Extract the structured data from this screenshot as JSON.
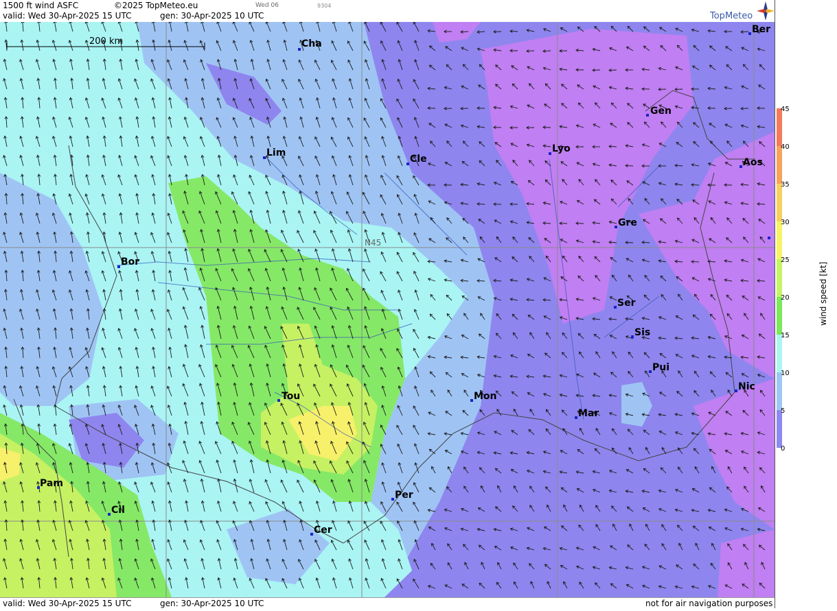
{
  "header": {
    "product": "1500 ft wind ASFC",
    "copyright": "©2025 TopMeteo.eu",
    "day_short": "Wed 06",
    "code": "9304",
    "valid": "valid:  Wed  30-Apr-2025  15 UTC",
    "gen": "gen:  30-Apr-2025 10 UTC",
    "brand": "TopMeteo"
  },
  "footer": {
    "valid": "valid:  Wed  30-Apr-2025  15 UTC",
    "gen": "gen:  30-Apr-2025 10 UTC",
    "disclaimer": "not for air navigation purposes"
  },
  "map": {
    "scale_label": "200 km",
    "lat_label": "N45",
    "cities": [
      {
        "name": "Cha",
        "key": "chateauroux"
      },
      {
        "name": "Ber",
        "key": "bern"
      },
      {
        "name": "Gen",
        "key": "geneva"
      },
      {
        "name": "Lim",
        "key": "limoges"
      },
      {
        "name": "Cle",
        "key": "clermont"
      },
      {
        "name": "Lyo",
        "key": "lyon"
      },
      {
        "name": "Aos",
        "key": "aosta"
      },
      {
        "name": "Gre",
        "key": "grenoble"
      },
      {
        "name": "Bor",
        "key": "bordeaux"
      },
      {
        "name": "Ser",
        "key": "serres"
      },
      {
        "name": "Sis",
        "key": "sisteron"
      },
      {
        "name": "Pui",
        "key": "puimoisson"
      },
      {
        "name": "Tou",
        "key": "toulouse"
      },
      {
        "name": "Mon",
        "key": "montpellier"
      },
      {
        "name": "Nic",
        "key": "nice"
      },
      {
        "name": "Mar",
        "key": "marseille"
      },
      {
        "name": "Pam",
        "key": "pamplona"
      },
      {
        "name": "Cil",
        "key": "cildamoc"
      },
      {
        "name": "Per",
        "key": "perpignan"
      },
      {
        "name": "Cer",
        "key": "cerdanya"
      }
    ]
  },
  "legend": {
    "title": "wind speed [kt]",
    "ticks": [
      "45",
      "40",
      "35",
      "30",
      "25",
      "20",
      "15",
      "10",
      "5",
      "0"
    ],
    "colors": [
      "#f47a5a",
      "#f8a35a",
      "#f9cf5e",
      "#f7f464",
      "#c4f564",
      "#7ce85c",
      "#aaf6f2",
      "#9dc7f4",
      "#8d88f2",
      "#c383f3"
    ]
  },
  "colors": {
    "lightblue": "#9fc4f4",
    "cyan": "#aaf4f4",
    "green": "#86e867",
    "yellowgreen": "#c6f163",
    "yellow": "#f7f06a",
    "blue_purple": "#8e86ee",
    "violet": "#c07ff2",
    "arrow": "#1a1a1a"
  }
}
